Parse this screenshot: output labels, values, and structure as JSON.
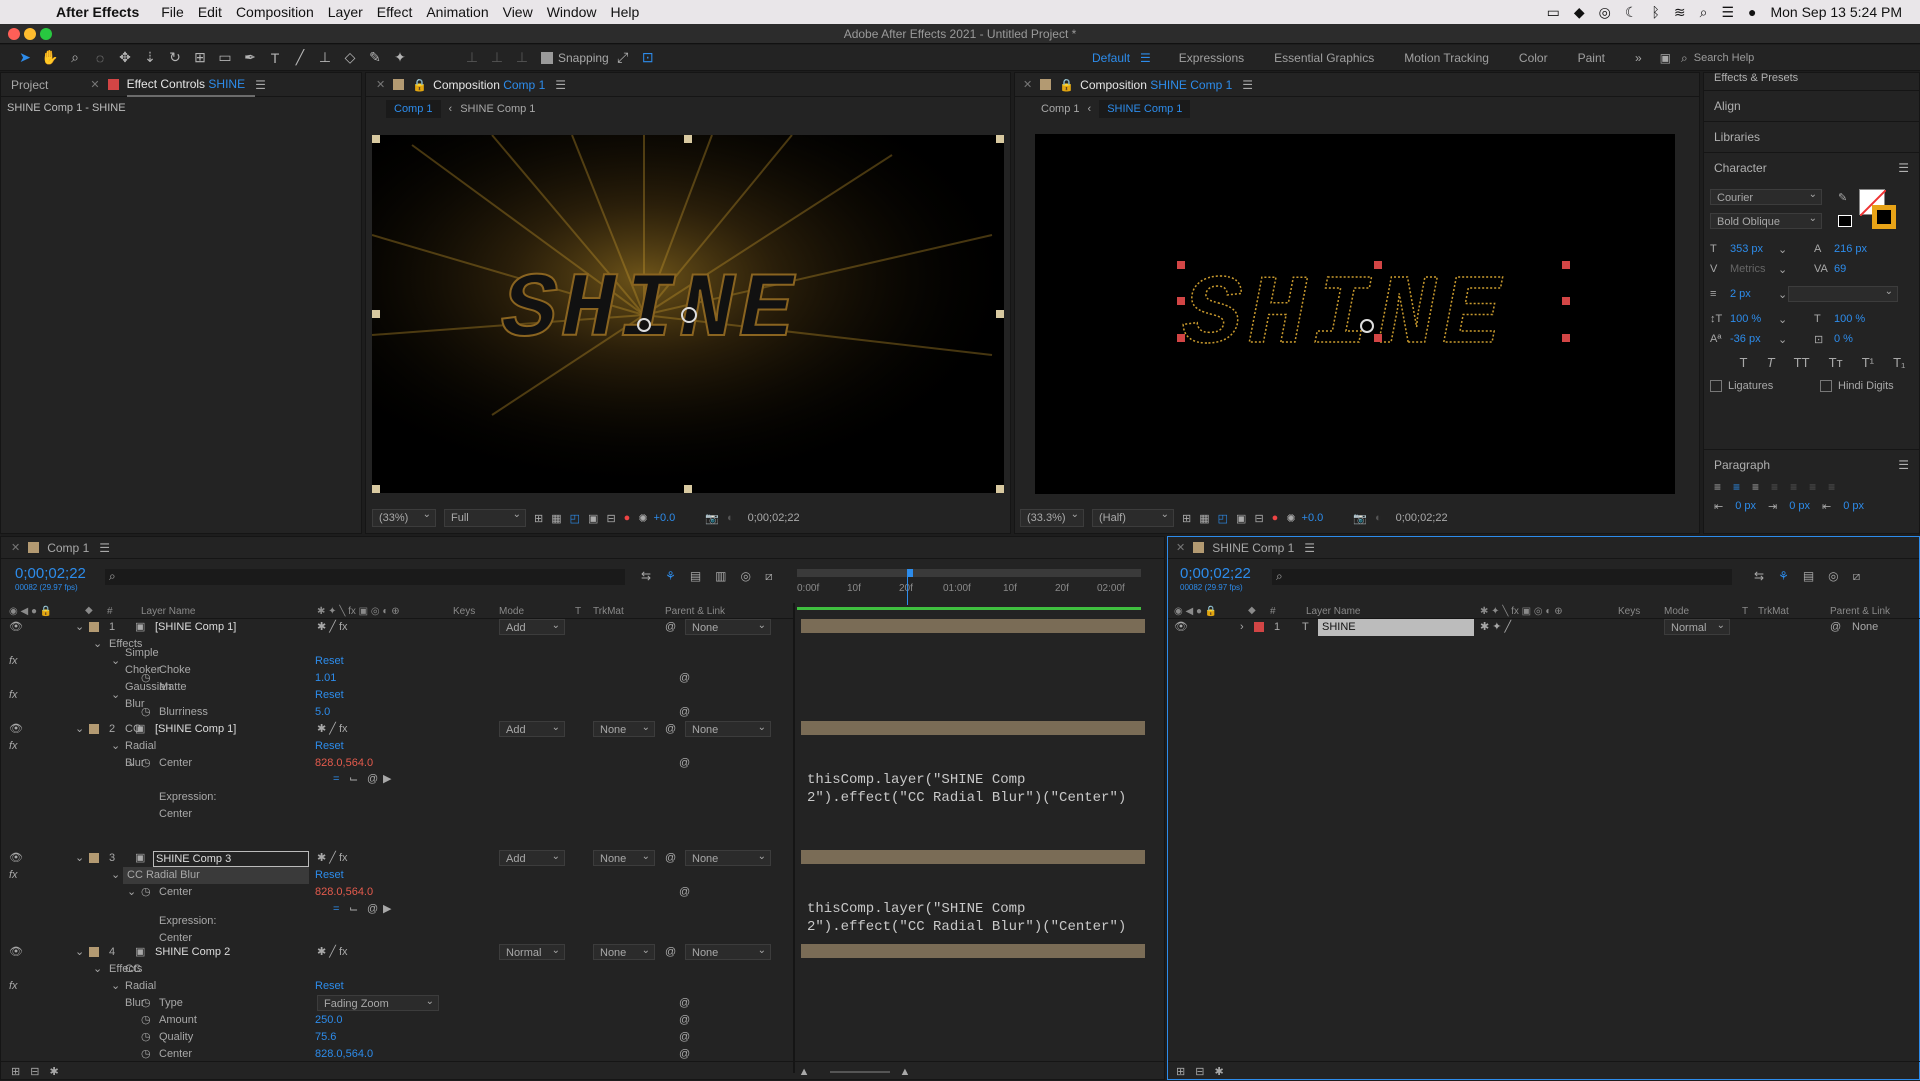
{
  "menubar": {
    "app": "After Effects",
    "items": [
      "File",
      "Edit",
      "Composition",
      "Layer",
      "Effect",
      "Animation",
      "View",
      "Window",
      "Help"
    ],
    "datetime": "Mon Sep 13  5:24 PM"
  },
  "window": {
    "title": "Adobe After Effects 2021 - Untitled Project *"
  },
  "toolbar": {
    "snapping": "Snapping",
    "workspaces": [
      "Default",
      "Expressions",
      "Essential Graphics",
      "Motion Tracking",
      "Color",
      "Paint"
    ],
    "search_placeholder": "Search Help"
  },
  "project_panel": {
    "tab_project": "Project",
    "tab_effect_prefix": "Effect Controls",
    "tab_effect_layer": "SHINE",
    "subtitle": "SHINE Comp 1 - SHINE"
  },
  "comp1_viewer": {
    "tab_prefix": "Composition",
    "tab_name": "Comp 1",
    "crumb_active": "Comp 1",
    "crumb_other": "SHINE Comp 1",
    "zoom": "(33%)",
    "resolution": "Full",
    "exposure": "+0.0",
    "timecode": "0;00;02;22",
    "text": "SHINE"
  },
  "shine_viewer": {
    "tab_prefix": "Composition",
    "tab_name": "SHINE Comp 1",
    "crumb_other": "Comp 1",
    "crumb_active": "SHINE Comp 1",
    "zoom": "(33.3%)",
    "resolution": "(Half)",
    "exposure": "+0.0",
    "timecode": "0;00;02;22",
    "text": "SHINE"
  },
  "right_panel": {
    "effects_presets": "Effects & Presets",
    "align": "Align",
    "libraries": "Libraries",
    "character": "Character",
    "font": "Courier",
    "style": "Bold Oblique",
    "size": "353 px",
    "leading": "216 px",
    "kerning": "Metrics",
    "tracking": "69",
    "stroke": "2 px",
    "vscale": "100 %",
    "hscale": "100 %",
    "baseline": "-36 px",
    "tsume": "0 %",
    "ligatures": "Ligatures",
    "hindi": "Hindi Digits",
    "paragraph": "Paragraph",
    "indent1": "0 px",
    "indent2": "0 px",
    "indent3": "0 px"
  },
  "timeline_left": {
    "tab": "Comp 1",
    "timecode": "0;00;02;22",
    "fps": "00082 (29.97 fps)",
    "headers": {
      "num": "#",
      "layer": "Layer Name",
      "keys": "Keys",
      "mode": "Mode",
      "t": "T",
      "trkmat": "TrkMat",
      "parent": "Parent & Link"
    },
    "ruler": [
      "0:00f",
      "10f",
      "20f",
      "01:00f",
      "10f",
      "20f",
      "02:00f"
    ],
    "layers": [
      {
        "num": "1",
        "name": "[SHINE Comp 1]",
        "mode": "Add",
        "trkmat": "",
        "parent": "None"
      },
      {
        "num": "2",
        "name": "[SHINE Comp 1]",
        "mode": "Add",
        "trkmat": "None",
        "parent": "None"
      },
      {
        "num": "3",
        "name": "SHINE Comp 3",
        "mode": "Add",
        "trkmat": "None",
        "parent": "None"
      },
      {
        "num": "4",
        "name": "SHINE Comp 2",
        "mode": "Normal",
        "trkmat": "None",
        "parent": "None"
      }
    ],
    "props": {
      "effects": "Effects",
      "simple_choker": "Simple Choker",
      "reset": "Reset",
      "choke_matte": "Choke Matte",
      "choke_val": "1.01",
      "gaussian": "Gaussian Blur",
      "blurriness": "Blurriness",
      "blur_val": "5.0",
      "cc_radial": "CC Radial Blur",
      "center": "Center",
      "center_val": "828.0,564.0",
      "expression_center": "Expression: Center",
      "type": "Type",
      "type_val": "Fading Zoom",
      "amount": "Amount",
      "amount_val": "250.0",
      "quality": "Quality",
      "quality_val": "75.6"
    },
    "expression_line1": "thisComp.layer(\"SHINE Comp",
    "expression_line2": "2\").effect(\"CC Radial Blur\")(\"Center\")"
  },
  "timeline_right": {
    "tab": "SHINE Comp 1",
    "timecode": "0;00;02;22",
    "fps": "00082 (29.97 fps)",
    "layer_num": "1",
    "layer_type": "T",
    "layer_name": "SHINE",
    "mode": "Normal",
    "parent": "None"
  },
  "colors": {
    "accent": "#2d8ceb",
    "label_tan": "#b39a72",
    "label_red": "#d24545",
    "gold": "#c99a2e"
  }
}
